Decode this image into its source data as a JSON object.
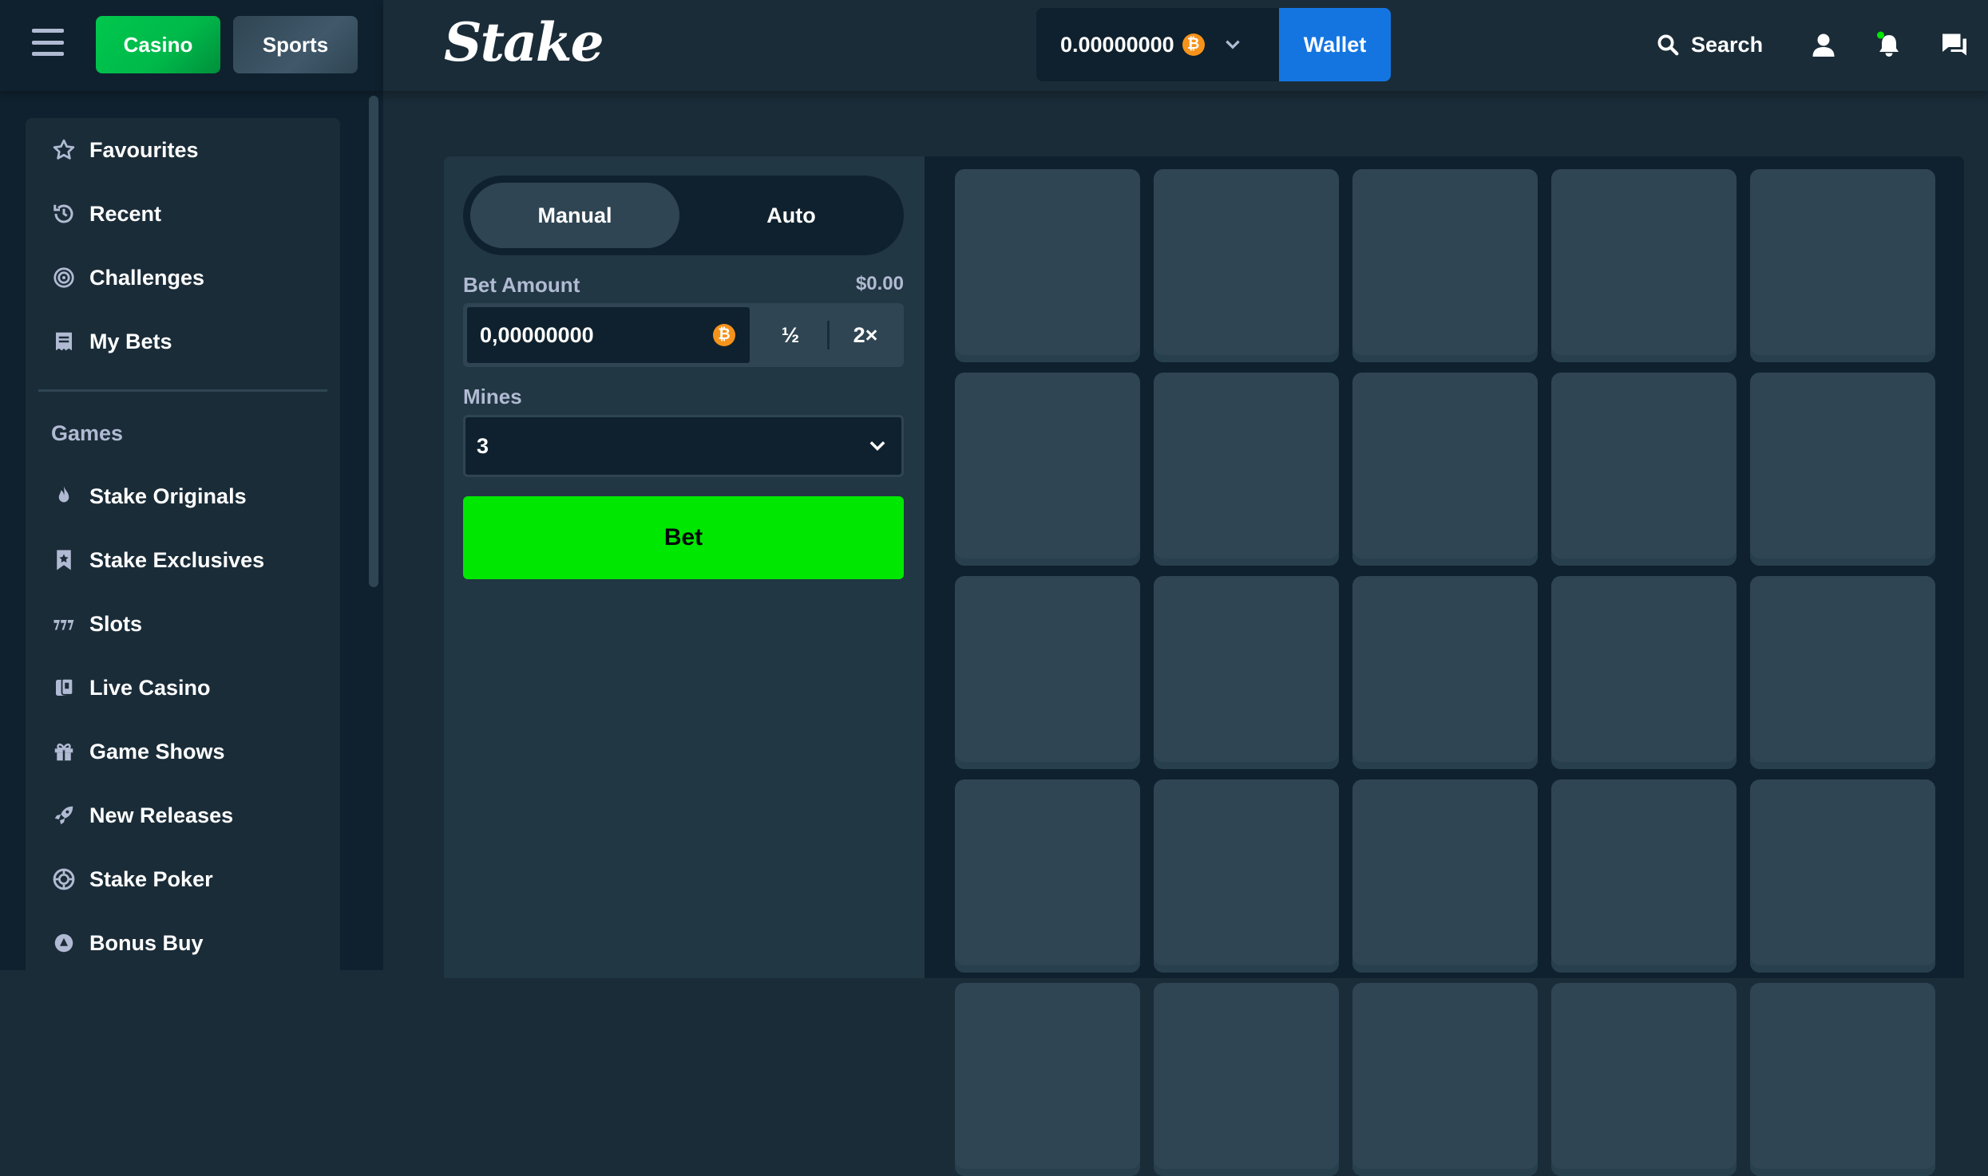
{
  "header": {
    "menu_icon": "hamburger-icon",
    "casino_label": "Casino",
    "sports_label": "Sports",
    "logo_text": "Stake",
    "balance": "0.00000000",
    "currency_icon": "bitcoin-icon",
    "currency_symbol": "₿",
    "wallet_label": "Wallet",
    "search_label": "Search",
    "icons": [
      "user-icon",
      "notifications-icon",
      "chat-icon"
    ]
  },
  "sidebar": {
    "colors": {
      "casino": "#00c74d",
      "sports": "#2f4553",
      "panel": "#1a2c38"
    },
    "top_items": [
      {
        "label": "Favourites",
        "icon": "star-icon"
      },
      {
        "label": "Recent",
        "icon": "history-icon"
      },
      {
        "label": "Challenges",
        "icon": "target-icon"
      },
      {
        "label": "My Bets",
        "icon": "receipt-icon"
      }
    ],
    "section_label": "Games",
    "game_items": [
      {
        "label": "Stake Originals",
        "icon": "fire-icon"
      },
      {
        "label": "Stake Exclusives",
        "icon": "bookmark-star-icon"
      },
      {
        "label": "Slots",
        "icon": "slots-icon"
      },
      {
        "label": "Live Casino",
        "icon": "cards-icon"
      },
      {
        "label": "Game Shows",
        "icon": "gift-icon"
      },
      {
        "label": "New Releases",
        "icon": "rocket-icon"
      },
      {
        "label": "Stake Poker",
        "icon": "poker-chip-icon"
      },
      {
        "label": "Bonus Buy",
        "icon": "bonus-icon"
      }
    ]
  },
  "game": {
    "tabs": [
      {
        "label": "Manual",
        "active": true
      },
      {
        "label": "Auto",
        "active": false
      }
    ],
    "bet_amount_label": "Bet Amount",
    "bet_amount_usd": "$0.00",
    "bet_amount_value": "0,00000000",
    "half_label": "½",
    "double_label": "2×",
    "mines_label": "Mines",
    "mines_value": "3",
    "bet_button_label": "Bet",
    "bet_button_color": "#00e701",
    "tile_color": "#2f4553",
    "grid_rows": 5,
    "grid_cols": 5
  }
}
